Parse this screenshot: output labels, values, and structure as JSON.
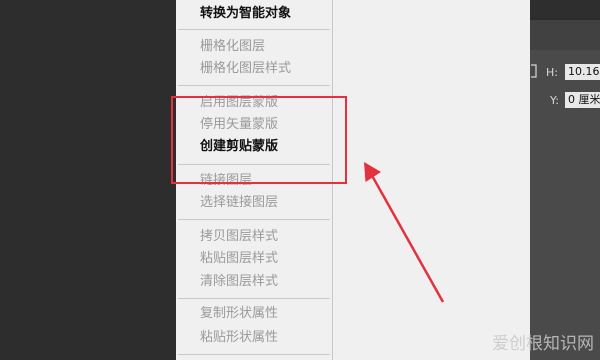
{
  "context_menu": {
    "items": [
      {
        "label": "转换为智能对象",
        "enabled": true
      },
      {
        "label": "栅格化图层",
        "enabled": false
      },
      {
        "label": "栅格化图层样式",
        "enabled": false
      },
      {
        "label": "启用图层蒙版",
        "enabled": false
      },
      {
        "label": "停用矢量蒙版",
        "enabled": false
      },
      {
        "label": "创建剪贴蒙版",
        "enabled": true
      },
      {
        "label": "链接图层",
        "enabled": false
      },
      {
        "label": "选择链接图层",
        "enabled": false
      },
      {
        "label": "拷贝图层样式",
        "enabled": false
      },
      {
        "label": "粘贴图层样式",
        "enabled": false
      },
      {
        "label": "清除图层样式",
        "enabled": false
      },
      {
        "label": "复制形状属性",
        "enabled": false
      },
      {
        "label": "粘贴形状属性",
        "enabled": false
      }
    ]
  },
  "properties": {
    "h_label": "H:",
    "h_value": "10.16",
    "y_label": "Y:",
    "y_value": "0 厘米"
  },
  "watermark": "爱创根知识网",
  "colors": {
    "highlight": "#e3313d",
    "menu_bg": "#f0f0f0",
    "workspace_bg": "#2b2b2b"
  }
}
